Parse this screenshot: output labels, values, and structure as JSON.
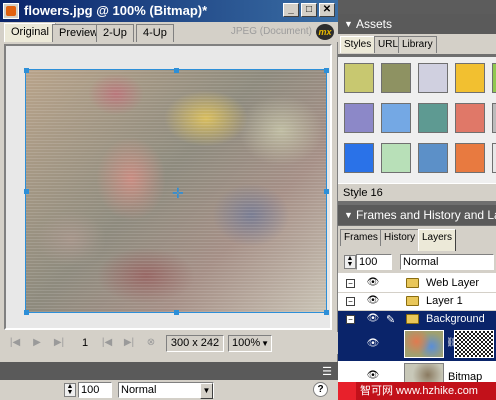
{
  "document": {
    "title": "flowers.jpg @  100% (Bitmap)*",
    "window_buttons": [
      "_",
      "□",
      "✕"
    ],
    "view_tabs": [
      "Original",
      "Preview",
      "2-Up",
      "4-Up"
    ],
    "format_label": "JPEG (Document)",
    "logo_text": "mx"
  },
  "statusbar": {
    "frame": "1",
    "image_size": "300 x 242",
    "zoom": "100%"
  },
  "property_bar": {
    "opacity": "100",
    "blend_mode": "Normal",
    "help": "?"
  },
  "assets_panel": {
    "title": "Assets",
    "tabs": [
      "Styles",
      "URL",
      "Library"
    ],
    "style_label": "Style 16",
    "swatch_colors": [
      [
        "#c8c870",
        "#8e9262",
        "#d0d0e0",
        "#f2c030",
        "#90c850"
      ],
      [
        "#8c88c8",
        "#74a8e4",
        "#5e9a92",
        "#e07868",
        "#bcbcbc"
      ],
      [
        "#2a72e8",
        "#b8e0b8",
        "#5c90c8",
        "#e87a40",
        "#e8e8e8"
      ]
    ]
  },
  "layers_panel": {
    "title": "Frames and History and La",
    "tabs": [
      "Frames",
      "History",
      "Layers"
    ],
    "opacity": "100",
    "blend_mode": "Normal",
    "layers": [
      {
        "name": "Web Layer"
      },
      {
        "name": "Layer 1"
      },
      {
        "name": "Background"
      }
    ],
    "object_name": "Bitmap"
  },
  "watermark": "智可网  www.hzhike.com"
}
